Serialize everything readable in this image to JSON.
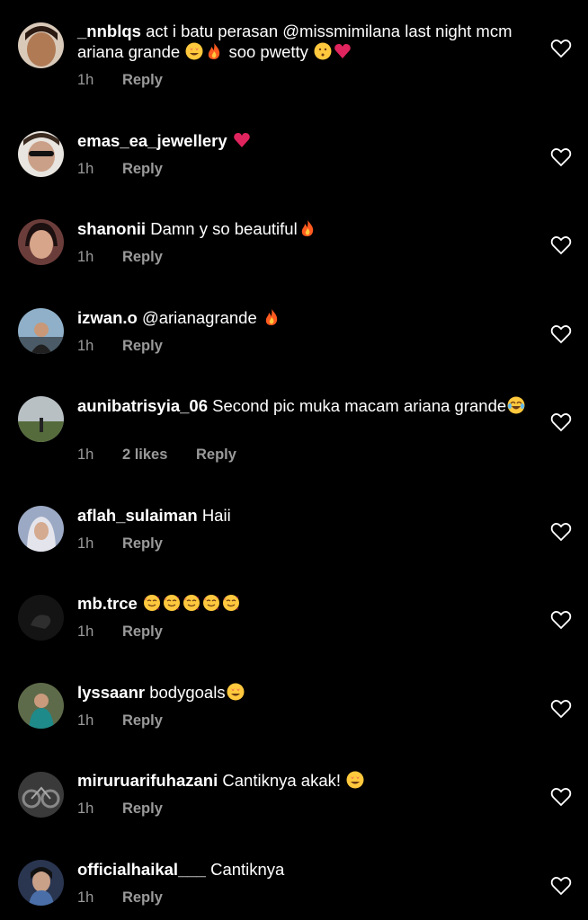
{
  "comments": [
    {
      "username": "_nnblqs",
      "text": "act i batu perasan @missmimilana last night mcm ariana grande",
      "emojis_after": [
        "heart-eyes",
        "fire"
      ],
      "text2": "soo pwetty",
      "emojis_end": [
        "kissing",
        "red-heart"
      ],
      "time": "1h",
      "reply": "Reply"
    },
    {
      "username": "emas_ea_jewellery",
      "text": "",
      "emojis_after": [
        "red-heart"
      ],
      "time": "1h",
      "reply": "Reply"
    },
    {
      "username": "shanonii",
      "text": "Damn y so beautiful",
      "emojis_after": [
        "fire"
      ],
      "time": "1h",
      "reply": "Reply"
    },
    {
      "username": "izwan.o",
      "text": "@arianagrande",
      "emojis_after": [
        "fire"
      ],
      "time": "1h",
      "reply": "Reply"
    },
    {
      "username": "aunibatrisyia_06",
      "text": "Second pic muka macam ariana grande",
      "emojis_after": [
        "joy"
      ],
      "time": "1h",
      "likes": "2 likes",
      "reply": "Reply"
    },
    {
      "username": "aflah_sulaiman",
      "text": "Haii",
      "emojis_after": [],
      "time": "1h",
      "reply": "Reply"
    },
    {
      "username": "mb.trce",
      "text": "",
      "emojis_after": [
        "smiling-hearts",
        "smiling-hearts",
        "smiling-hearts",
        "smiling-hearts",
        "smiling-hearts"
      ],
      "time": "1h",
      "reply": "Reply"
    },
    {
      "username": "lyssaanr",
      "text": "bodygoals",
      "emojis_after": [
        "heart-eyes"
      ],
      "time": "1h",
      "reply": "Reply"
    },
    {
      "username": "miruruarifuhazani",
      "text": "Cantiknya akak!",
      "emojis_after": [
        "heart-eyes"
      ],
      "time": "1h",
      "reply": "Reply"
    },
    {
      "username": "officialhaikal___",
      "text": "Cantiknya",
      "emojis_after": [],
      "time": "1h",
      "reply": "Reply"
    }
  ],
  "icons": {
    "like": "heart-outline-icon"
  },
  "colors": {
    "background": "#000000",
    "text": "#ffffff",
    "meta": "#9a9a9a"
  }
}
